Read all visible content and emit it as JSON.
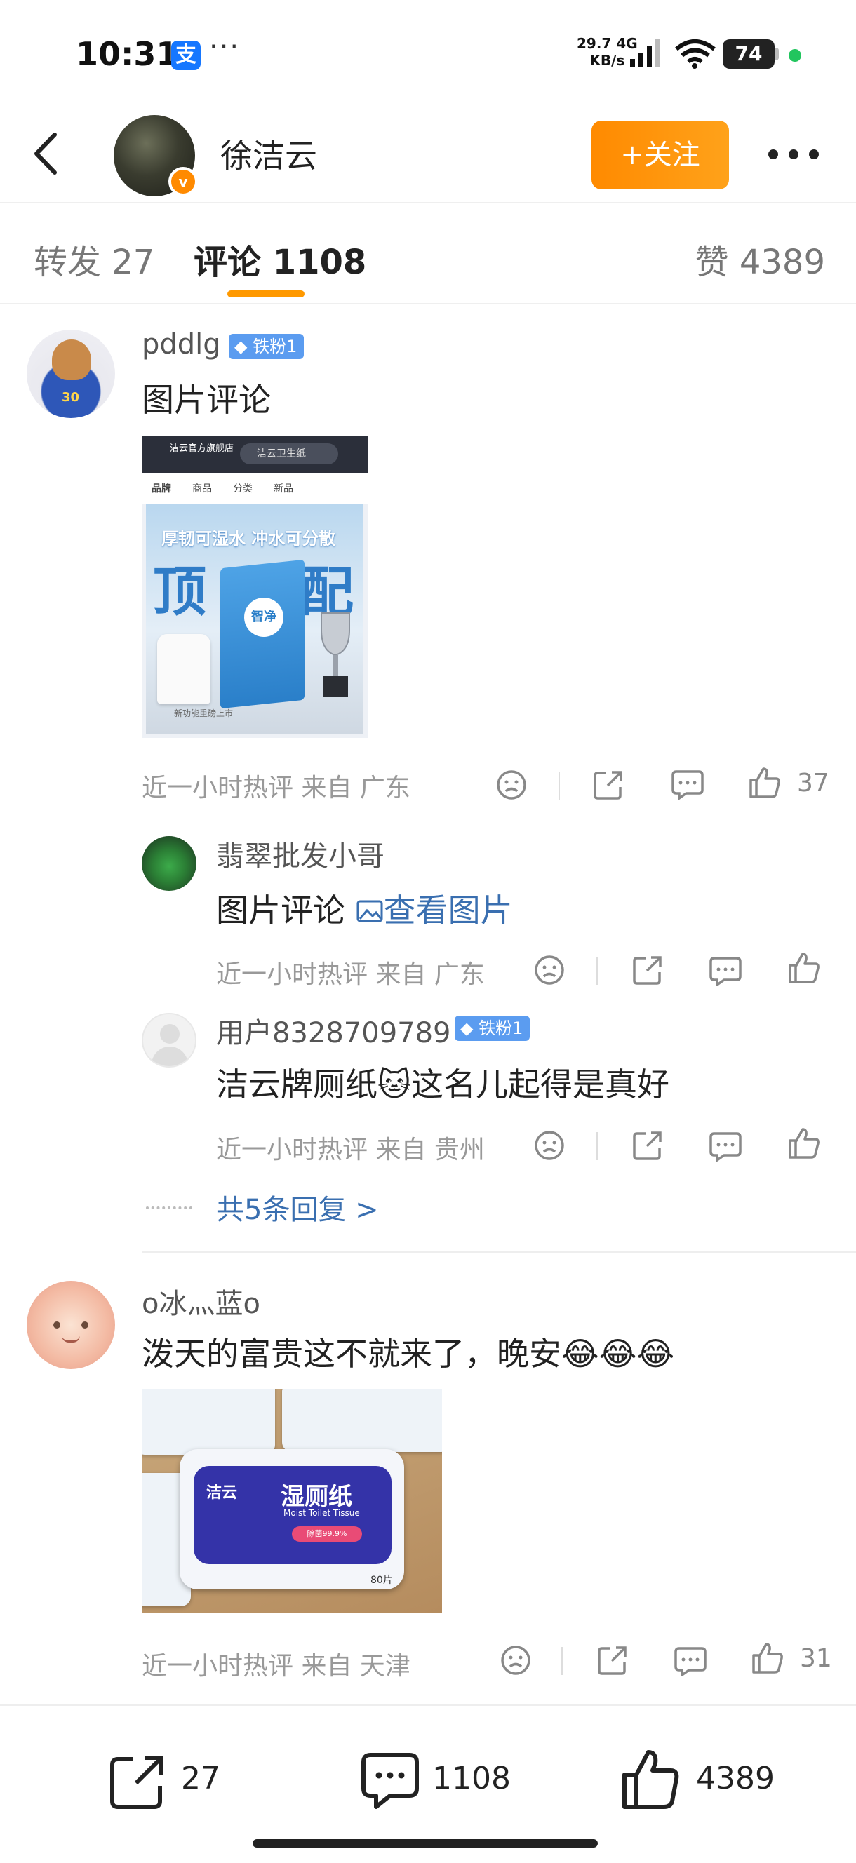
{
  "status_bar": {
    "time": "10:31",
    "app_icon": "支",
    "more": "···",
    "net_speed_top": "29.7 4G",
    "net_speed_bottom": "KB/s",
    "wifi_label": "7",
    "battery": "74",
    "colors": {
      "alipay": "#1677ff",
      "dot": "#22c55e"
    }
  },
  "header": {
    "username": "徐洁云",
    "verified_badge": "v",
    "follow_button": "+关注",
    "icons": {
      "back": "back-arrow-icon",
      "more": "more-dots-icon"
    },
    "colors": {
      "follow": "#ff9900"
    }
  },
  "tabs": [
    {
      "label": "转发 27"
    },
    {
      "label": "评论 1108",
      "active": true
    },
    {
      "label": "赞 4389"
    }
  ],
  "comments": [
    {
      "username": "pddlg",
      "badge": "铁粉1",
      "text": "图片评论",
      "image": {
        "shop": "洁云官方旗舰店",
        "search": "洁云卫生纸",
        "nav": [
          "品牌",
          "商品",
          "分类",
          "新品"
        ],
        "slogan": "厚韧可湿水  冲水可分散",
        "big_left": "顶",
        "big_right": "配",
        "box_label": "智净",
        "footer": "新功能重磅上市"
      },
      "meta": "近一小时热评  来自 广东",
      "likes": "37",
      "replies": [
        {
          "username": "翡翠批发小哥",
          "text": "图片评论 ",
          "link": "查看图片",
          "meta": "近一小时热评  来自 广东"
        },
        {
          "username": "用户8328709789",
          "badge": "铁粉1",
          "text": "洁云牌厕纸🐱这名儿起得是真好",
          "meta": "近一小时热评  来自 贵州"
        }
      ],
      "more_replies": "共5条回复 >"
    },
    {
      "username": "o冰灬蓝o",
      "text": "泼天的富贵这不就来了，晚安😂😂😂",
      "image": {
        "brand": "洁云",
        "title": "湿厕纸",
        "subtitle": "Moist Toilet Tissue",
        "pill": "除菌99.9%",
        "count": "80片"
      },
      "meta": "近一小时热评  来自 天津",
      "likes": "31"
    }
  ],
  "bottom_bar": {
    "repost_count": "27",
    "comment_count": "1108",
    "like_count": "4389"
  }
}
